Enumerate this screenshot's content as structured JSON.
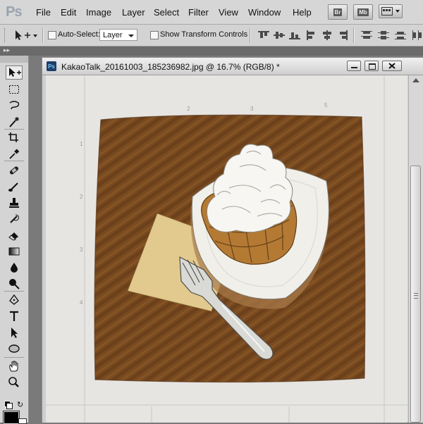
{
  "app": {
    "logo_text": "Ps",
    "menu": [
      "File",
      "Edit",
      "Image",
      "Layer",
      "Select",
      "Filter",
      "View",
      "Window",
      "Help"
    ],
    "launch_bridge": "Br",
    "launch_minibridge": "Mb"
  },
  "options_bar": {
    "auto_select_label": "Auto-Select:",
    "auto_select_value": "Layer",
    "show_transform_label": "Show Transform Controls",
    "auto_select_checked": false,
    "show_transform_checked": false
  },
  "toolbox": {
    "selected_tool": "move",
    "tools": [
      "move",
      "rectangular-marquee",
      "lasso",
      "quick-selection",
      "crop",
      "eyedropper",
      "spot-healing-brush",
      "brush",
      "clone-stamp",
      "history-brush",
      "eraser",
      "gradient",
      "blur",
      "dodge",
      "pen",
      "type",
      "path-selection",
      "ellipse",
      "hand",
      "zoom"
    ],
    "foreground_color": "#000000",
    "background_color": "#ffffff"
  },
  "document": {
    "title": "KakaoTalk_20161003_185236982.jpg @ 16.7% (RGB/8) *",
    "colors": {
      "paper": "#e6e5e2",
      "coffee": "#7a4b20",
      "plate": "#f1efe9",
      "napkin": "#e2c98d",
      "waffle": "#b47a34",
      "cream": "#f7f6f2",
      "fork": "#d9d9d6"
    }
  }
}
